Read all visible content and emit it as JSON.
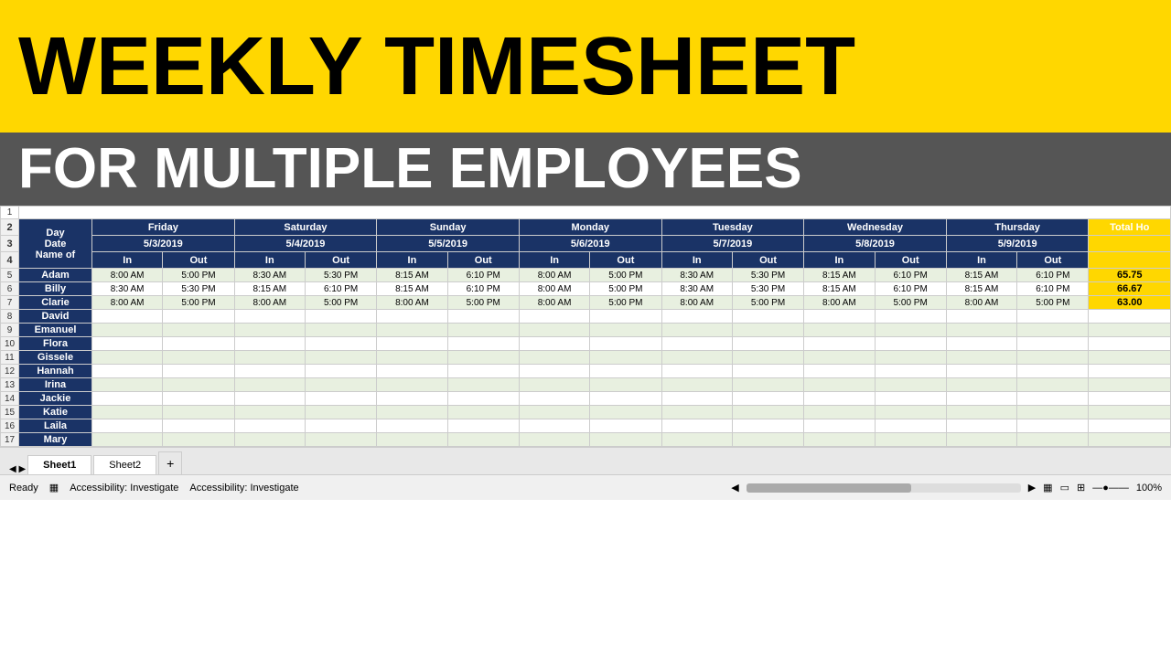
{
  "header": {
    "line1": "WEEKLY TIMESHEET",
    "line2": "FOR MULTIPLE EMPLOYEES"
  },
  "columns": {
    "day_label": "Day",
    "date_label": "Date",
    "name_label": "Name of",
    "days": [
      {
        "day": "Friday",
        "date": "5/3/2019"
      },
      {
        "day": "Saturday",
        "date": "5/4/2019"
      },
      {
        "day": "Sunday",
        "date": "5/5/2019"
      },
      {
        "day": "Monday",
        "date": "5/6/2019"
      },
      {
        "day": "Tuesday",
        "date": "5/7/2019"
      },
      {
        "day": "Wednesday",
        "date": "5/8/2019"
      },
      {
        "day": "Thursday",
        "date": "5/9/2019"
      }
    ],
    "in_label": "In",
    "out_label": "Out",
    "total_label": "Total Ho"
  },
  "employees": [
    {
      "name": "Adam",
      "times": [
        {
          "in": "8:00 AM",
          "out": "5:00 PM"
        },
        {
          "in": "8:30 AM",
          "out": "5:30 PM"
        },
        {
          "in": "8:15 AM",
          "out": "6:10 PM"
        },
        {
          "in": "8:00 AM",
          "out": "5:00 PM"
        },
        {
          "in": "8:30 AM",
          "out": "5:30 PM"
        },
        {
          "in": "8:15 AM",
          "out": "6:10 PM"
        },
        {
          "in": "8:15 AM",
          "out": "6:10 PM"
        }
      ],
      "total": "65.75"
    },
    {
      "name": "Billy",
      "times": [
        {
          "in": "8:30 AM",
          "out": "5:30 PM"
        },
        {
          "in": "8:15 AM",
          "out": "6:10 PM"
        },
        {
          "in": "8:15 AM",
          "out": "6:10 PM"
        },
        {
          "in": "8:00 AM",
          "out": "5:00 PM"
        },
        {
          "in": "8:30 AM",
          "out": "5:30 PM"
        },
        {
          "in": "8:15 AM",
          "out": "6:10 PM"
        },
        {
          "in": "8:15 AM",
          "out": "6:10 PM"
        }
      ],
      "total": "66.67"
    },
    {
      "name": "Clarie",
      "times": [
        {
          "in": "8:00 AM",
          "out": "5:00 PM"
        },
        {
          "in": "8:00 AM",
          "out": "5:00 PM"
        },
        {
          "in": "8:00 AM",
          "out": "5:00 PM"
        },
        {
          "in": "8:00 AM",
          "out": "5:00 PM"
        },
        {
          "in": "8:00 AM",
          "out": "5:00 PM"
        },
        {
          "in": "8:00 AM",
          "out": "5:00 PM"
        },
        {
          "in": "8:00 AM",
          "out": "5:00 PM"
        }
      ],
      "total": "63.00"
    },
    {
      "name": "David",
      "times": [],
      "total": ""
    },
    {
      "name": "Emanuel",
      "times": [],
      "total": ""
    },
    {
      "name": "Flora",
      "times": [],
      "total": ""
    },
    {
      "name": "Gissele",
      "times": [],
      "total": ""
    },
    {
      "name": "Hannah",
      "times": [],
      "total": ""
    },
    {
      "name": "Irina",
      "times": [],
      "total": ""
    },
    {
      "name": "Jackie",
      "times": [],
      "total": ""
    },
    {
      "name": "Katie",
      "times": [],
      "total": ""
    },
    {
      "name": "Laila",
      "times": [],
      "total": ""
    },
    {
      "name": "Mary",
      "times": [],
      "total": ""
    }
  ],
  "tabs": [
    "Sheet1",
    "Sheet2"
  ],
  "status": {
    "ready": "Ready",
    "zoom": "100%",
    "accessibility": "Accessibility: Investigate"
  },
  "row_numbers": [
    1,
    2,
    3,
    4,
    5,
    6,
    7,
    8,
    9,
    10,
    11,
    12,
    13,
    14,
    15,
    16,
    17
  ]
}
